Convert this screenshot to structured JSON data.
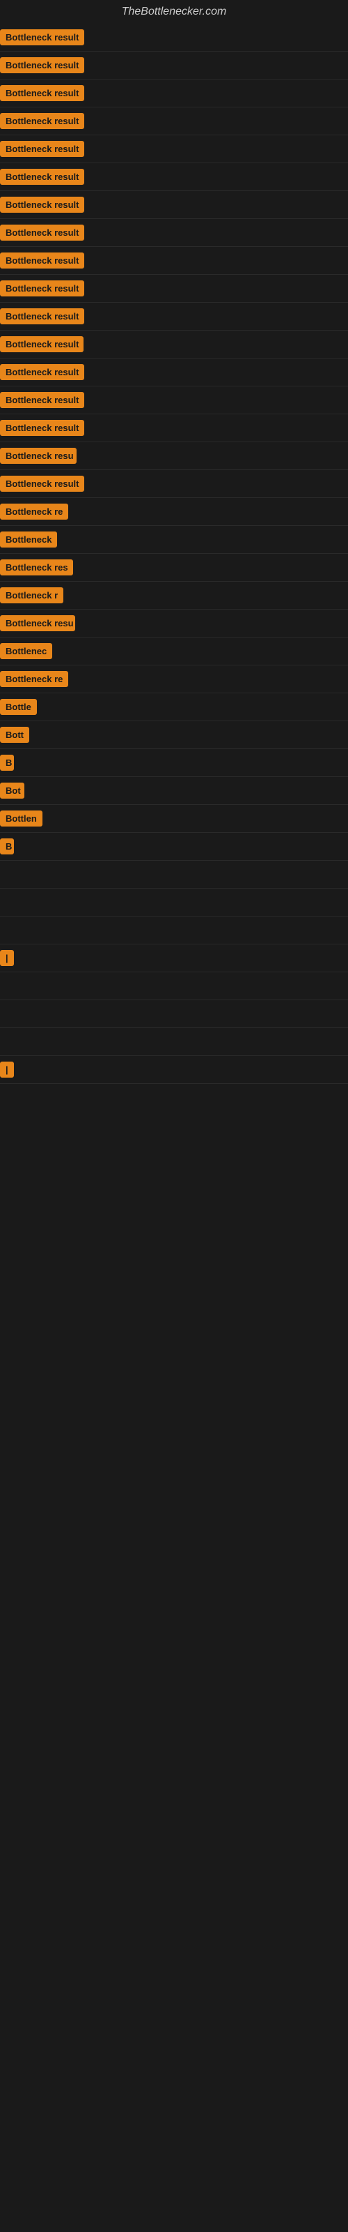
{
  "site": {
    "title": "TheBottlenecker.com"
  },
  "items": [
    {
      "label": "Bottleneck result",
      "width": 130
    },
    {
      "label": "Bottleneck result",
      "width": 128
    },
    {
      "label": "Bottleneck result",
      "width": 128
    },
    {
      "label": "Bottleneck result",
      "width": 125
    },
    {
      "label": "Bottleneck result",
      "width": 128
    },
    {
      "label": "Bottleneck result",
      "width": 125
    },
    {
      "label": "Bottleneck result",
      "width": 128
    },
    {
      "label": "Bottleneck result",
      "width": 125
    },
    {
      "label": "Bottleneck result",
      "width": 128
    },
    {
      "label": "Bottleneck result",
      "width": 125
    },
    {
      "label": "Bottleneck result",
      "width": 128
    },
    {
      "label": "Bottleneck result",
      "width": 120
    },
    {
      "label": "Bottleneck result",
      "width": 125
    },
    {
      "label": "Bottleneck result",
      "width": 125
    },
    {
      "label": "Bottleneck result",
      "width": 122
    },
    {
      "label": "Bottleneck resu",
      "width": 110
    },
    {
      "label": "Bottleneck result",
      "width": 122
    },
    {
      "label": "Bottleneck re",
      "width": 100
    },
    {
      "label": "Bottleneck",
      "width": 85
    },
    {
      "label": "Bottleneck res",
      "width": 105
    },
    {
      "label": "Bottleneck r",
      "width": 92
    },
    {
      "label": "Bottleneck resu",
      "width": 108
    },
    {
      "label": "Bottlenec",
      "width": 82
    },
    {
      "label": "Bottleneck re",
      "width": 100
    },
    {
      "label": "Bottle",
      "width": 60
    },
    {
      "label": "Bott",
      "width": 45
    },
    {
      "label": "B",
      "width": 20
    },
    {
      "label": "Bot",
      "width": 35
    },
    {
      "label": "Bottlen",
      "width": 65
    },
    {
      "label": "B",
      "width": 18
    },
    {
      "label": "",
      "width": 0
    },
    {
      "label": "",
      "width": 0
    },
    {
      "label": "",
      "width": 0
    },
    {
      "label": "|",
      "width": 15
    },
    {
      "label": "",
      "width": 0
    },
    {
      "label": "",
      "width": 0
    },
    {
      "label": "",
      "width": 0
    },
    {
      "label": "|",
      "width": 15
    }
  ]
}
